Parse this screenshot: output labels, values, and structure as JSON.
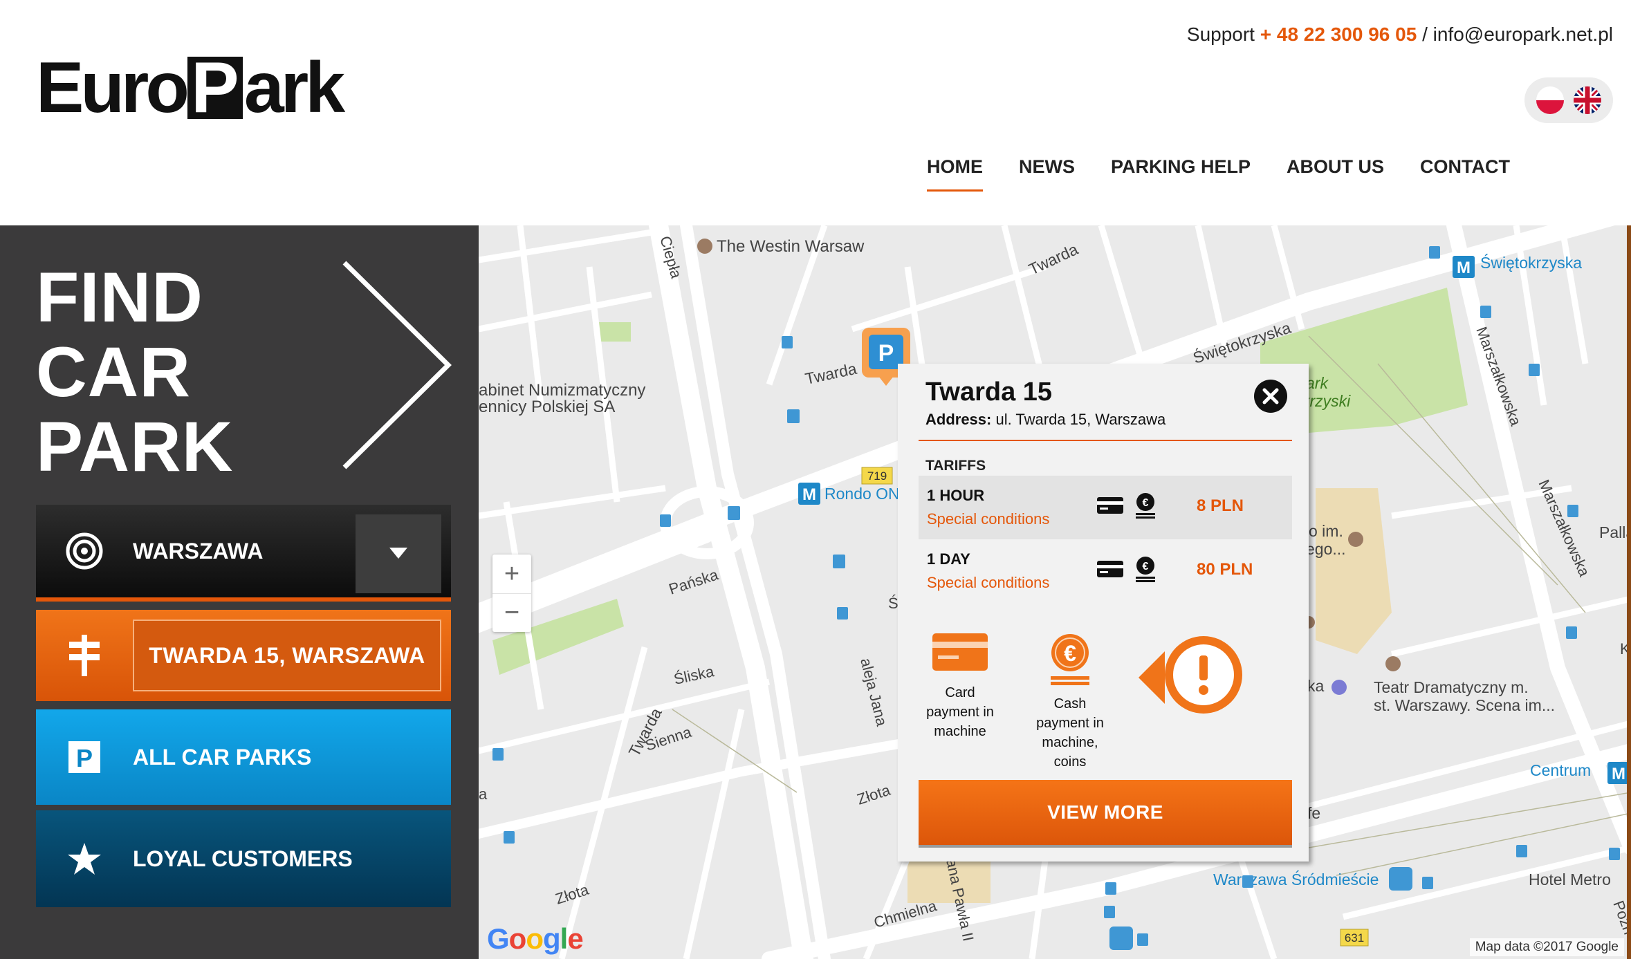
{
  "header": {
    "logo_left": "Euro",
    "logo_p": "P",
    "logo_right": "ark",
    "support_label": "Support",
    "support_phone": "+ 48 22 300 96 05",
    "support_sep": "/",
    "support_email": "info@europark.net.pl",
    "langs": [
      "pl-flag-icon",
      "uk-flag-icon"
    ]
  },
  "nav": {
    "items": [
      "HOME",
      "NEWS",
      "PARKING HELP",
      "ABOUT US",
      "CONTACT"
    ],
    "active": "HOME"
  },
  "sidebar": {
    "title_line1": "FIND",
    "title_line2": "CAR",
    "title_line3": "PARK",
    "city": "WARSZAWA",
    "location": "TWARDA 15, WARSZAWA",
    "all_car_parks": "ALL CAR PARKS",
    "loyal_customers": "LOYAL CUSTOMERS"
  },
  "map": {
    "labels": {
      "westin": "The Westin Warsaw",
      "twarda_n": "Twarda",
      "twarda_w": "Twarda",
      "twarda_s": "Twarda",
      "swietokrzyska_st": "Świętokrzyska",
      "swietokrzyska_metro": "Świętokrzyska",
      "rondo": "Rondo ONZ",
      "numizmat1": "abinet Numizmatyczny",
      "numizmat2": "ennicy Polskiej SA",
      "panska": "Pańska",
      "sliska": "Śliska",
      "sienna": "Sienna",
      "zlota1": "Złota",
      "zlota2": "Złota",
      "chmielna": "Chmielna",
      "jana_pawla": "aleja Jana",
      "jana_pawla2": "aleja Jana Pa",
      "jana_pawla3": "ana Pawła II",
      "marsz1": "Marszałkowska",
      "marsz2": "Marszałkowska",
      "park1": "ark",
      "park2": "krzyski",
      "teatr1": "Teatr Dramatyczny m.",
      "teatr2": "st. Warszawy. Scena im...",
      "im1": "o im.",
      "im2": "ego...",
      "ka": "ka",
      "fe": "fe",
      "pallad": "Pallad",
      "centrum": "Centrum",
      "srodmiescie": "Warszawa Śródmieście",
      "hotel": "Hotel Metro",
      "road719": "719",
      "road631": "631",
      "cieplа": "Ciepła",
      "edge_a": "a",
      "edge_k": "K",
      "edge_s": "Ś",
      "pozn": "Pozn"
    },
    "zoom_in": "+",
    "zoom_out": "−",
    "google": "Google",
    "attribution": "Map data ©2017 Google"
  },
  "popup": {
    "title": "Twarda 15",
    "address_label": "Address:",
    "address": "ul. Twarda 15, Warszawa",
    "tariffs_label": "TARIFFS",
    "tariffs": [
      {
        "name": "1 HOUR",
        "cond": "Special conditions",
        "price": "8 PLN"
      },
      {
        "name": "1 DAY",
        "cond": "Special conditions",
        "price": "80 PLN"
      }
    ],
    "payment_card_1": "Card",
    "payment_card_2": "payment in",
    "payment_card_3": "machine",
    "payment_cash_1": "Cash",
    "payment_cash_2": "payment in",
    "payment_cash_3": "machine,",
    "payment_cash_4": "coins",
    "view_more": "VIEW MORE"
  },
  "colors": {
    "accent": "#e4570a",
    "sidebar": "#3b3a3b",
    "blue": "#0a86c6",
    "dark_blue": "#033553"
  }
}
